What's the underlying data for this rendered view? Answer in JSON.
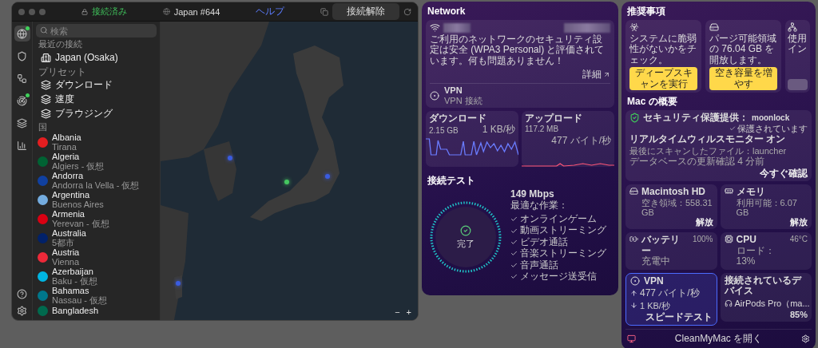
{
  "vpn_window": {
    "status": "接続済み",
    "server": "Japan #644",
    "help": "ヘルプ",
    "disconnect": "接続解除",
    "rail": [
      {
        "kind": "globe",
        "selected": true,
        "badge": true
      },
      {
        "kind": "shield",
        "selected": false,
        "badge": false
      },
      {
        "kind": "mesh",
        "selected": false,
        "badge": false
      },
      {
        "kind": "radar",
        "selected": false,
        "badge": true
      },
      {
        "kind": "layers",
        "selected": false,
        "badge": false
      },
      {
        "kind": "stats",
        "selected": false,
        "badge": false
      }
    ],
    "search": {
      "placeholder": "検索"
    },
    "recent": {
      "heading": "最近の接続",
      "items": [
        "Japan (Osaka)"
      ]
    },
    "presets": {
      "heading": "プリセット",
      "items": [
        "ダウンロード",
        "速度",
        "ブラウジング"
      ]
    },
    "countries": {
      "heading": "国",
      "items": [
        {
          "name": "Albania",
          "city": "Tirana",
          "color": "#e41e20"
        },
        {
          "name": "Algeria",
          "city": "Algiers - 仮想",
          "color": "#006233"
        },
        {
          "name": "Andorra",
          "city": "Andorra la Vella - 仮想",
          "color": "#1040a0"
        },
        {
          "name": "Argentina",
          "city": "Buenos Aires",
          "color": "#74acdf"
        },
        {
          "name": "Armenia",
          "city": "Yerevan - 仮想",
          "color": "#d90012"
        },
        {
          "name": "Australia",
          "city": "5都市",
          "color": "#012169"
        },
        {
          "name": "Austria",
          "city": "Vienna",
          "color": "#ed2939"
        },
        {
          "name": "Azerbaijan",
          "city": "Baku - 仮想",
          "color": "#00b5e2"
        },
        {
          "name": "Bahamas",
          "city": "Nassau - 仮想",
          "color": "#00778b"
        },
        {
          "name": "Bangladesh",
          "color": "#006a4e"
        }
      ]
    },
    "map": {
      "pins": [
        {
          "selected": false
        },
        {
          "selected": true
        },
        {
          "selected": false
        },
        {
          "selected": false
        }
      ],
      "zoom_out": "−",
      "zoom_in": "+"
    }
  },
  "network": {
    "title": "Network",
    "security_text": "ご利用のネットワークのセキュリティ設定は安全 (WPA3 Personal) と評価されています。何も問題ありません！",
    "details_link": "詳細",
    "vpn_title": "VPN",
    "vpn_status": "VPN 接続",
    "download": {
      "title": "ダウンロード",
      "total": "2.15 GB",
      "rate": "1 KB/秒"
    },
    "upload": {
      "title": "アップロード",
      "total": "117.2 MB",
      "rate": "477 バイト/秒"
    },
    "speed_test": {
      "title": "接続テスト",
      "status": "完了",
      "speed": "149 Mbps",
      "best_for": "最適な作業：",
      "activities": [
        "オンラインゲーム",
        "動画ストリーミング",
        "ビデオ通話",
        "音楽ストリーミング",
        "音声通話",
        "メッセージ送受信"
      ]
    }
  },
  "cleanmymac": {
    "recommendations_title": "推奨事項",
    "recommendations": [
      {
        "kind": "biohazard",
        "text": "システムに脆弱性がないかをチェック。",
        "button": "ディープスキャンを実行"
      },
      {
        "kind": "disk",
        "text": "パージ可能領域の 76.04 GB を開放します。",
        "button": "空き容量を増やす"
      },
      {
        "kind": "network",
        "text": "使用イン"
      }
    ],
    "overview_title": "Mac の概要",
    "security": {
      "provider_label": "セキュリティ保護提供：",
      "brand": "moonlock",
      "status": "保護されています",
      "monitor": "リアルタイムウィルスモニター オン",
      "last_scan": "最後にスキャンしたファイル：launcher",
      "db_check": "データベースの更新確認 4 分前",
      "check_now": "今すぐ確認"
    },
    "tiles": [
      {
        "kind": "disk",
        "title": "Macintosh HD",
        "detail": "空き領域：558.31 GB",
        "action": "解放"
      },
      {
        "kind": "memory",
        "title": "メモリ",
        "detail": "利用可能：6.07 GB",
        "action": "解放"
      },
      {
        "kind": "battery",
        "title": "バッテリー",
        "detail": "充電中",
        "value": "100%"
      },
      {
        "kind": "cpu",
        "title": "CPU",
        "detail": "ロード：13%",
        "value": "46°C"
      }
    ],
    "vpn_tile": {
      "title": "VPN",
      "up": "477 バイト/秒",
      "down": "1 KB/秒",
      "action": "スピードテスト",
      "selected": true
    },
    "devices": {
      "title": "接続されているデバイス",
      "name": "AirPods Pro（ma...",
      "battery": "85%"
    },
    "footer": "CleanMyMac を開く"
  }
}
